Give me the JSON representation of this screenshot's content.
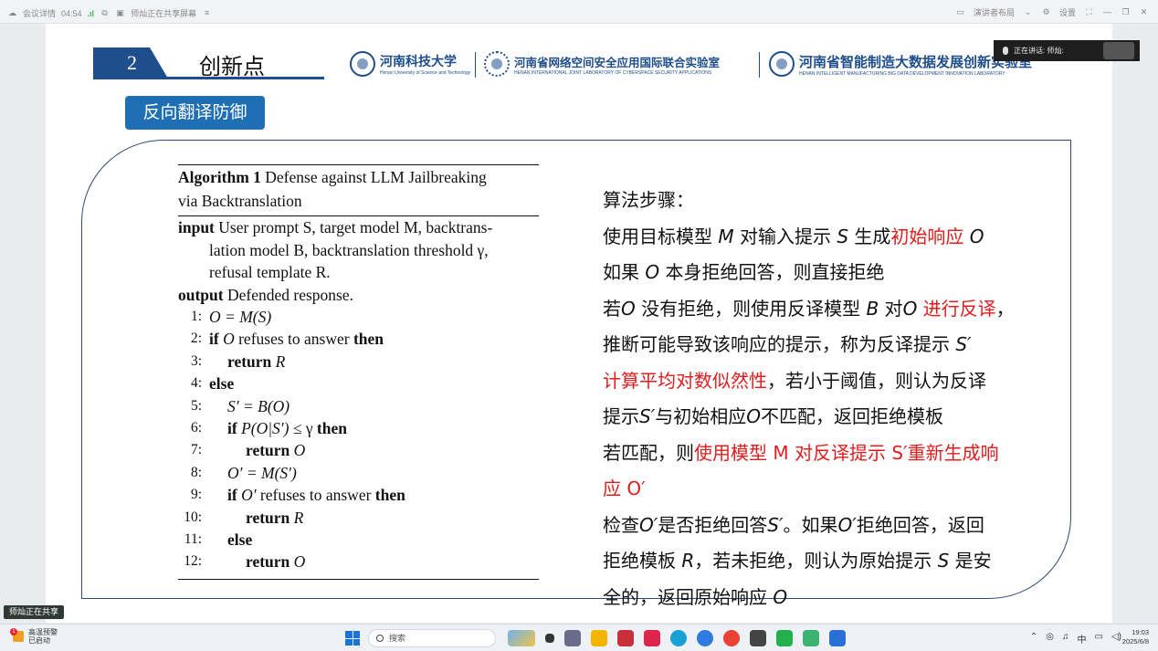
{
  "topbar": {
    "left": [
      "会议详情",
      "04:54",
      "师灿正在共享屏幕"
    ],
    "right": [
      "演讲者布局",
      "设置"
    ]
  },
  "slide": {
    "number": "2",
    "section_title": "创新点",
    "logos": [
      {
        "name": "河南科技大学",
        "sub": "Henan University of Science and Technology"
      },
      {
        "name": "河南省网络空间安全应用国际联合实验室",
        "sub": "HENAN INTERNATIONAL JOINT LABORATORY OF CYBERSPACE SECURITY APPLICATIONS"
      },
      {
        "name": "河南省智能制造大数据发展创新实验室",
        "sub": "HENAN INTELLIGENT MANUFACTURING BIG DATA DEVELOPMENT INNOVATION LABORATORY"
      }
    ],
    "badge": "反向翻译防御",
    "algorithm": {
      "title_bold": "Algorithm 1",
      "title_rest": " Defense against LLM Jailbreaking",
      "title_line2": "via Backtranslation",
      "input_kw": "input",
      "input_text": "User prompt S, target model M, backtrans-",
      "input_l2": "lation model B, backtranslation threshold γ,",
      "input_l3": "refusal template R.",
      "output_kw": "output",
      "output_text": "Defended response.",
      "lines": [
        {
          "n": "1:",
          "text": "O = M(S)"
        },
        {
          "n": "2:",
          "text": "if O refuses to answer then"
        },
        {
          "n": "3:",
          "text": "return R"
        },
        {
          "n": "4:",
          "text": "else"
        },
        {
          "n": "5:",
          "text": "S′ = B(O)"
        },
        {
          "n": "6:",
          "text": "if P(O|S′) ≤ γ  then"
        },
        {
          "n": "7:",
          "text": "return O"
        },
        {
          "n": "8:",
          "text": "O′ = M(S′)"
        },
        {
          "n": "9:",
          "text": "if O′ refuses to answer then"
        },
        {
          "n": "10:",
          "text": "return R"
        },
        {
          "n": "11:",
          "text": "else"
        },
        {
          "n": "12:",
          "text": "return O"
        }
      ]
    },
    "steps": {
      "heading": "算法步骤：",
      "l1a": "使用目标模型 ",
      "l1b": "M",
      "l1c": " 对输入提示 ",
      "l1d": "S",
      "l1e": " 生成",
      "l1red": "初始响应",
      "l1f": " O",
      "l2a": "如果 ",
      "l2b": "O",
      "l2c": " 本身拒绝回答，则直接拒绝",
      "l3a": "若",
      "l3b": "O",
      "l3c": " 没有拒绝，则使用反译模型 ",
      "l3d": "B",
      "l3e": " 对",
      "l3f": "O",
      "l3red": " 进行反译",
      "l3g": "，",
      "l4a": "推断可能导致该响应的提示，称为反译提示 ",
      "l4b": "S′",
      "l5red": "计算平均对数似然性",
      "l5a": "，若小于阈值，则认为反译",
      "l6a": "提示",
      "l6b": "S′",
      "l6c": "与初始相应",
      "l6d": "O",
      "l6e": "不匹配，返回拒绝模板",
      "l7a": "若匹配，则",
      "l7red": "使用模型 M 对反译提示 S′重新生成响",
      "l8red": "应 O′",
      "l9a": "检查",
      "l9b": "O′",
      "l9c": "是否拒绝回答",
      "l9d": "S′",
      "l9e": "。如果",
      "l9f": "O′",
      "l9g": "拒绝回答，返回",
      "l10a": "拒绝模板 ",
      "l10b": "R",
      "l10c": "，若未拒绝，则认为原始提示 ",
      "l10d": "S",
      "l10e": " 是安",
      "l11a": "全的，返回原始响应 ",
      "l11b": "O"
    }
  },
  "overlay": {
    "speaking": "正在讲话: 师灿:",
    "share_pill": "师灿正在共享"
  },
  "taskbar": {
    "weather_title": "高温预警",
    "weather_sub": "已启动",
    "weather_badge": "1",
    "search": "搜索",
    "tray": [
      "中"
    ],
    "time": "19:03",
    "date": "2025/6/8"
  },
  "colors": {
    "accent": "#1f4e8c",
    "badge": "#1f6fb4",
    "highlight": "#e21c1c"
  }
}
